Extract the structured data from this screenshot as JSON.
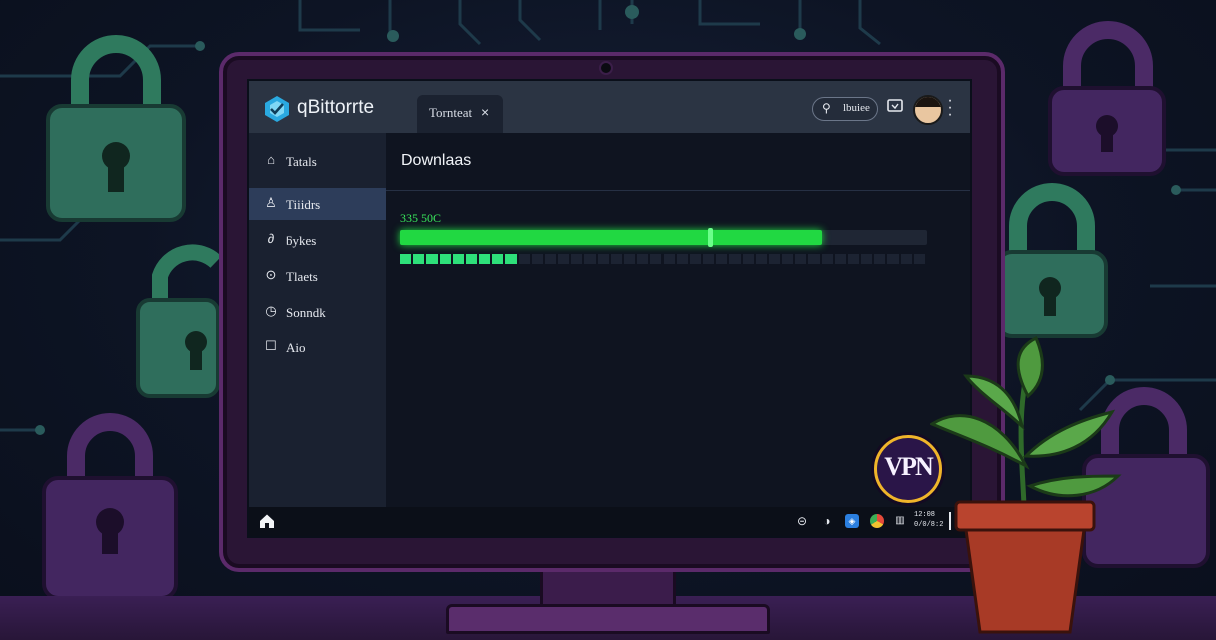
{
  "app": {
    "name": "qBittorrte",
    "tab_label": "Tornteat",
    "tab_close": "×"
  },
  "topbar": {
    "search_label": "lbuiee",
    "search_icon": "search-icon",
    "screen_icon": "monitor-icon",
    "menu_icon": "kebab-icon"
  },
  "sidebar": {
    "items": [
      {
        "label": "Tatals",
        "icon": "home-icon",
        "glyph": "⌂",
        "active": false
      },
      {
        "label": "Tiiidrs",
        "icon": "user-icon",
        "glyph": "♙",
        "active": true
      },
      {
        "label": "ƃykes",
        "icon": "link-icon",
        "glyph": "∂",
        "active": false
      },
      {
        "label": "Tlaets",
        "icon": "pin-icon",
        "glyph": "⊙",
        "active": false
      },
      {
        "label": "Sonndk",
        "icon": "clock-icon",
        "glyph": "◷",
        "active": false
      },
      {
        "label": "Aio",
        "icon": "square-icon",
        "glyph": "☐",
        "active": false
      }
    ]
  },
  "main": {
    "title": "Downlaas",
    "speed": "335 50C",
    "progress": 0.8,
    "pieces_total": 40,
    "pieces_done": 9
  },
  "taskbar": {
    "clock_line1": "12:08",
    "clock_line2": "0/0/8:2",
    "tray_icons": [
      "settings-icon",
      "network-icon",
      "shield-icon",
      "chrome-icon",
      "grid-icon"
    ]
  },
  "badge": {
    "text": "VPN"
  },
  "colors": {
    "accent": "#21d842",
    "pieces": "#2ee07a",
    "vpn_ring": "#f0b52a",
    "active_item": "#2d3d5a"
  }
}
